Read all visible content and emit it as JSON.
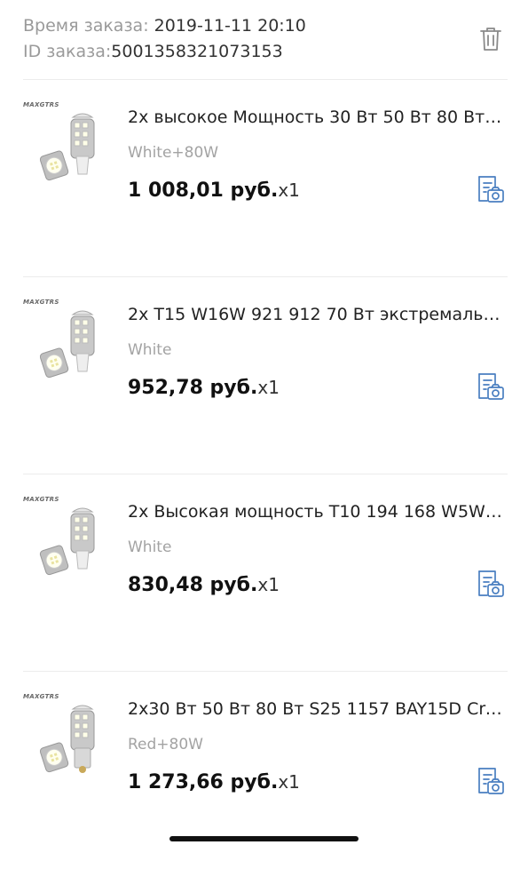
{
  "order": {
    "time_label": "Время заказа: ",
    "time_value": "2019-11-11 20:10",
    "id_label": "ID заказа:",
    "id_value": "5001358321073153"
  },
  "items": [
    {
      "brand": "MAXGTRS",
      "title": "2x высокое Мощность 30 Вт 50 Вт 80 Вт к...",
      "variant": "White+80W",
      "price": "1 008,01 руб.",
      "qty": "x1"
    },
    {
      "brand": "MAXGTRS",
      "title": "2x T15 W16W 921 912 70 Вт экстремально...",
      "variant": "White",
      "price": "952,78 руб.",
      "qty": "x1"
    },
    {
      "brand": "MAXGTRS",
      "title": "2x Высокая мощность T10 194 168 W5W 7...",
      "variant": "White",
      "price": "830,48 руб.",
      "qty": "x1"
    },
    {
      "brand": "MAXGTRS",
      "title": "2x30 Вт 50 Вт 80 Вт S25 1157 BAY15D Cree...",
      "variant": "Red+80W",
      "price": "1 273,66 руб.",
      "qty": "x1"
    }
  ],
  "icons": {
    "delete": "trash-icon",
    "review": "review-photo-icon",
    "accent": "#4a7fc1"
  }
}
